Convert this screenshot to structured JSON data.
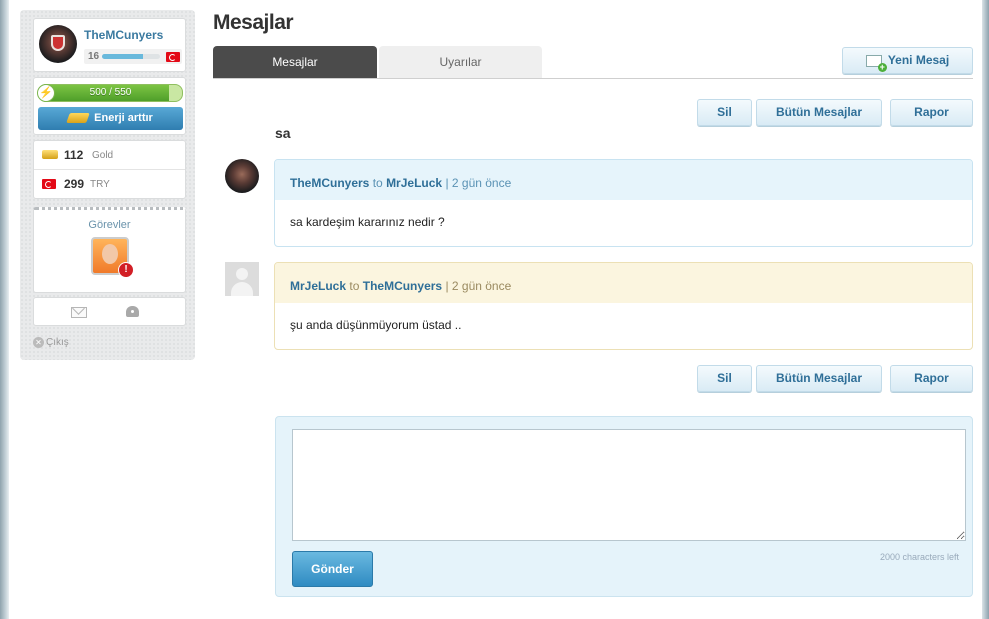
{
  "sidebar": {
    "username": "TheMCunyers",
    "level": "16",
    "xp_fraction": 0.7,
    "energy_text": "500 / 550",
    "energy_fraction": 0.91,
    "energy_button": "Enerji arttır",
    "gold_value": "112",
    "gold_label": "Gold",
    "try_value": "299",
    "try_label": "TRY",
    "tasks_title": "Görevler",
    "task_alert": "!",
    "logout": "Çıkış"
  },
  "main": {
    "title": "Mesajlar",
    "tabs": [
      {
        "label": "Mesajlar",
        "active": true
      },
      {
        "label": "Uyarılar",
        "active": false
      }
    ],
    "new_message": "Yeni Mesaj",
    "actions": {
      "delete": "Sil",
      "all_messages": "Bütün Mesajlar",
      "report": "Rapor"
    },
    "subject": "sa",
    "messages": [
      {
        "from": "TheMCunyers",
        "to_word": "to",
        "to": "MrJeLuck",
        "time": "| 2 gün önce",
        "text": "sa kardeşim kararınız nedir ?"
      },
      {
        "from": "MrJeLuck",
        "to_word": "to",
        "to": "TheMCunyers",
        "time": "| 2 gün önce",
        "text": "şu anda düşünmüyorum üstad .."
      }
    ],
    "reply": {
      "textarea_value": "",
      "send_label": "Gönder",
      "chars_left": "2000 characters left"
    }
  },
  "colors": {
    "accent": "#2f6f98",
    "energy": "#5aa42e",
    "tab_active": "#4b4b4b",
    "reply_bg": "#e5f3fa"
  }
}
